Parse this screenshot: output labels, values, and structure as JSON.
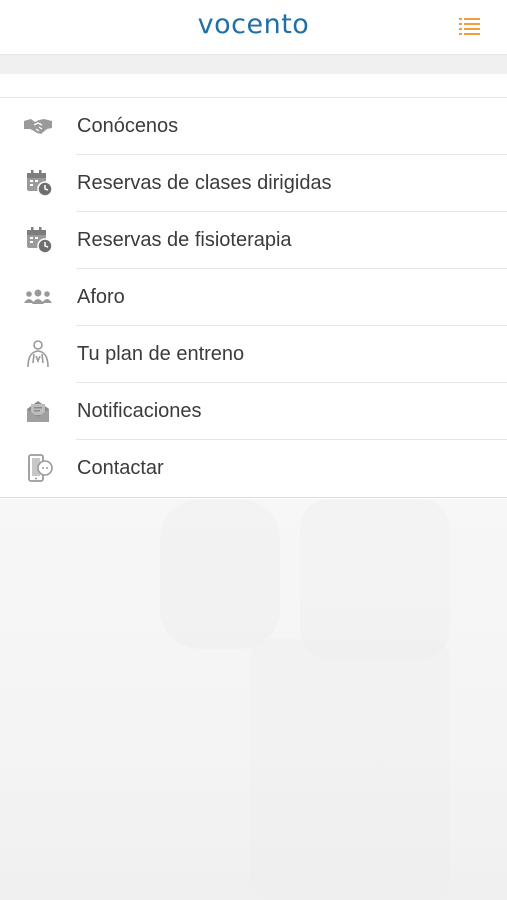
{
  "header": {
    "logo": "vocento",
    "menu_icon": "list-menu-icon",
    "accent_color": "#f39c3c",
    "brand_color": "#1f6fa8"
  },
  "menu": {
    "items": [
      {
        "label": "Conócenos",
        "icon": "handshake-icon"
      },
      {
        "label": "Reservas de clases dirigidas",
        "icon": "calendar-clock-icon"
      },
      {
        "label": "Reservas de fisioterapia",
        "icon": "calendar-clock-icon"
      },
      {
        "label": "Aforo",
        "icon": "group-people-icon"
      },
      {
        "label": "Tu plan de entreno",
        "icon": "trainer-person-icon"
      },
      {
        "label": "Notificaciones",
        "icon": "mail-notification-icon"
      },
      {
        "label": "Contactar",
        "icon": "contact-phone-icon"
      }
    ]
  }
}
